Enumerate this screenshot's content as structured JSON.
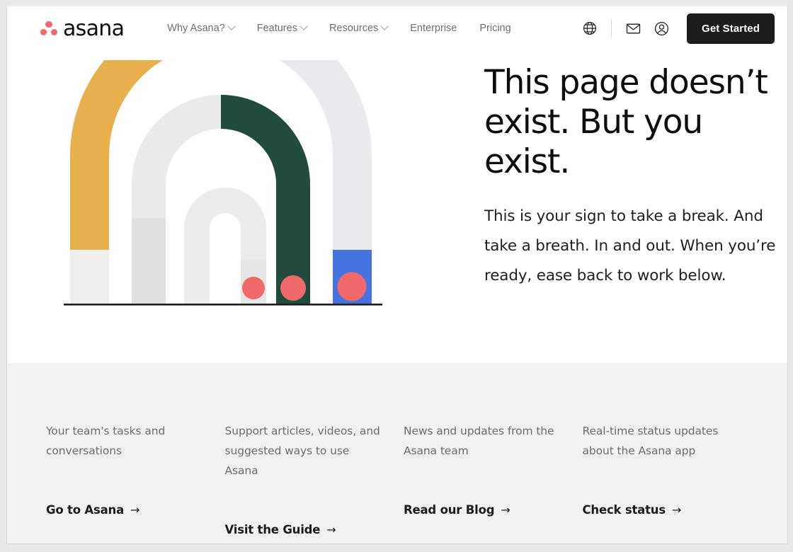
{
  "brand": {
    "logo_text": "asana",
    "logo_dot_color": "#f06a6a"
  },
  "header": {
    "nav": [
      {
        "label": "Why Asana?",
        "has_caret": true
      },
      {
        "label": "Features",
        "has_caret": true
      },
      {
        "label": "Resources",
        "has_caret": true
      },
      {
        "label": "Enterprise",
        "has_caret": false
      },
      {
        "label": "Pricing",
        "has_caret": false
      }
    ],
    "icons": [
      {
        "name": "globe-icon"
      },
      {
        "name": "mail-icon"
      },
      {
        "name": "account-icon"
      }
    ],
    "cta_label": "Get Started",
    "cta_bg": "#1b1c1d"
  },
  "hero": {
    "headline": "This page doesn’t exist. But you exist.",
    "subcopy": "This is your sign to take a break. And take a breath. In and out. When you’re ready, ease back to work below.",
    "illustration": {
      "name": "concentric-arches-illustration",
      "colors": {
        "amber": "#e9b14e",
        "blue": "#4573e0",
        "green": "#214b3d",
        "coral": "#f06a6a",
        "gray_light": "#efefef",
        "gray_mid": "#e4e4e4",
        "gray_pale": "#e9eaee",
        "ground": "#1b1c1d"
      }
    }
  },
  "footer": {
    "columns": [
      {
        "description": "Your team's tasks and conversations",
        "link_label": "Go to Asana",
        "arrow": "→"
      },
      {
        "description": "Support articles, videos, and suggested ways to use Asana",
        "link_label": "Visit the Guide",
        "arrow": "→"
      },
      {
        "description": "News and updates from the Asana team",
        "link_label": "Read our Blog",
        "arrow": "→"
      },
      {
        "description": "Real-time status updates about the Asana app",
        "link_label": "Check status",
        "arrow": "→"
      }
    ],
    "background": "#f2f1f0"
  }
}
